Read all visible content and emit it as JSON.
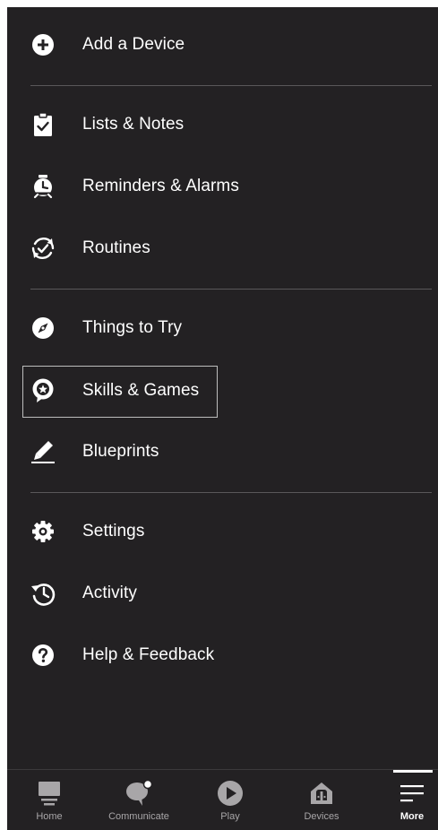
{
  "menu": {
    "add_device": "Add a Device",
    "lists_notes": "Lists & Notes",
    "reminders_alarms": "Reminders & Alarms",
    "routines": "Routines",
    "things_to_try": "Things to Try",
    "skills_games": "Skills & Games",
    "blueprints": "Blueprints",
    "settings": "Settings",
    "activity": "Activity",
    "help_feedback": "Help & Feedback"
  },
  "icons": {
    "add_device": "plus-circle-icon",
    "lists_notes": "clipboard-check-icon",
    "reminders_alarms": "alarm-clock-icon",
    "routines": "routine-check-icon",
    "things_to_try": "compass-icon",
    "skills_games": "star-bubble-icon",
    "blueprints": "pencil-icon",
    "settings": "gear-icon",
    "activity": "history-icon",
    "help_feedback": "question-circle-icon"
  },
  "tabbar": {
    "home": "Home",
    "communicate": "Communicate",
    "play": "Play",
    "devices": "Devices",
    "more": "More",
    "active": "More"
  },
  "colors": {
    "background": "#232123",
    "text": "#ffffff",
    "divider": "#5a585a",
    "tab_inactive": "#a8a6a8"
  }
}
